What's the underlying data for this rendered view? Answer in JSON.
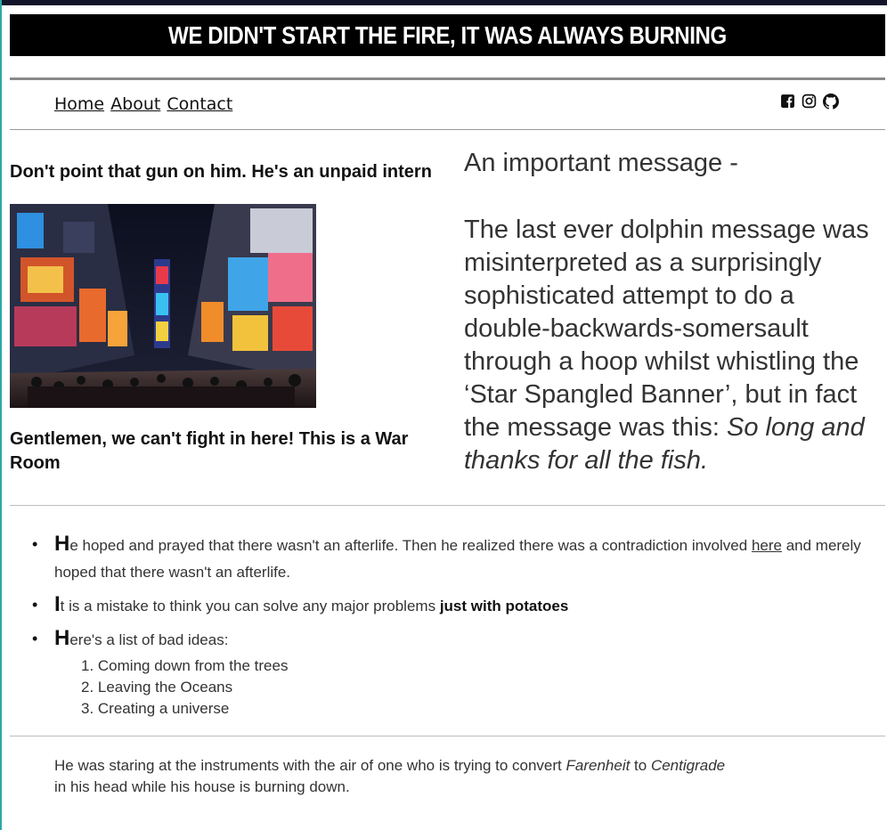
{
  "banner": {
    "title": "WE DIDN'T START THE FIRE, IT WAS ALWAYS BURNING"
  },
  "nav": {
    "items": [
      "Home",
      "About",
      "Contact"
    ]
  },
  "social": {
    "icons": [
      "facebook-icon",
      "instagram-icon",
      "github-icon"
    ]
  },
  "left": {
    "heading_top": "Don't point that gun on him. He's an unpaid intern",
    "heading_bottom": "Gentlemen, we can't fight in here! This is a War Room"
  },
  "message": {
    "title": "An important message -",
    "body": "The last ever dolphin message was misinterpreted as a surprisingly sophisticated attempt to do a double-backwards-somersault through a hoop whilst whistling the ‘Star Spangled Banner’, but in fact the message was this:",
    "quote": "So long and thanks for all the fish."
  },
  "list": {
    "item1": {
      "cap": "H",
      "text": "e hoped and prayed that there wasn't an afterlife. Then he realized there was a contradiction involved ",
      "link": "here",
      "text2": " and merely hoped that there wasn't an afterlife."
    },
    "item2": {
      "cap": "I",
      "text": "t is a mistake to think you can solve any major problems ",
      "bold": "just with potatoes"
    },
    "item3": {
      "cap": "H",
      "text": "ere's a list of bad ideas:",
      "sub": [
        "1. Coming down from the trees",
        "2. Leaving the Oceans",
        "3. Creating a universe"
      ]
    }
  },
  "footer": {
    "text1": "He was staring at the instruments with the air of one who is trying to convert ",
    "em1": "Farenheit",
    "text2": " to ",
    "em2": "Centigrade",
    "text3": " in his head while his house is burning down."
  }
}
